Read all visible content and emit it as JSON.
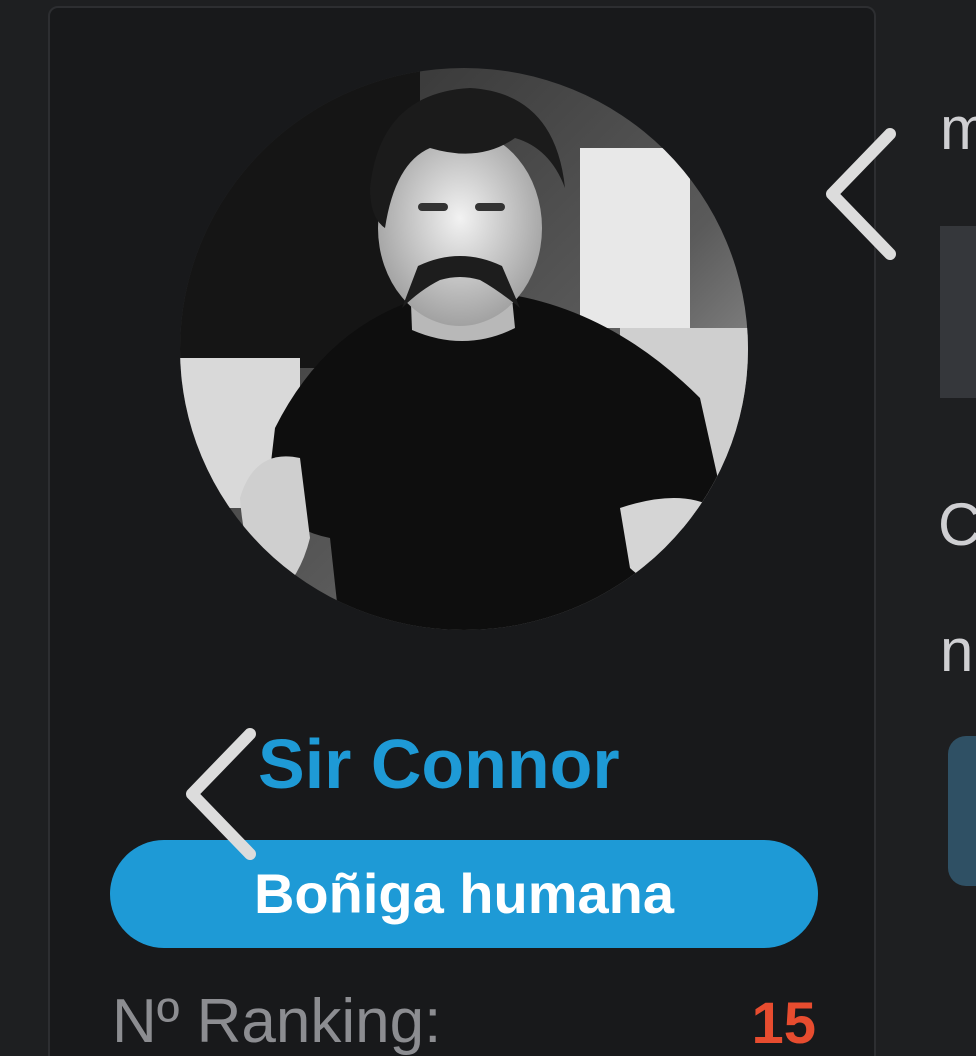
{
  "profile": {
    "username": "Sir Connor",
    "rank_title": "Boñiga humana",
    "ranking_label": "Nº Ranking:",
    "ranking_value": "15",
    "avatar_alt": "Sir Connor"
  },
  "right_column": {
    "letter_top": "m",
    "letter_mid_1": "C",
    "letter_mid_2": "n"
  },
  "colors": {
    "accent": "#1e9ad6",
    "ranking_value": "#e74c2f",
    "background": "#1e1f21",
    "card": "#18191b"
  },
  "icons": {
    "prev_arrow_top": "chevron-left-icon",
    "prev_arrow_avatar": "chevron-left-icon"
  }
}
